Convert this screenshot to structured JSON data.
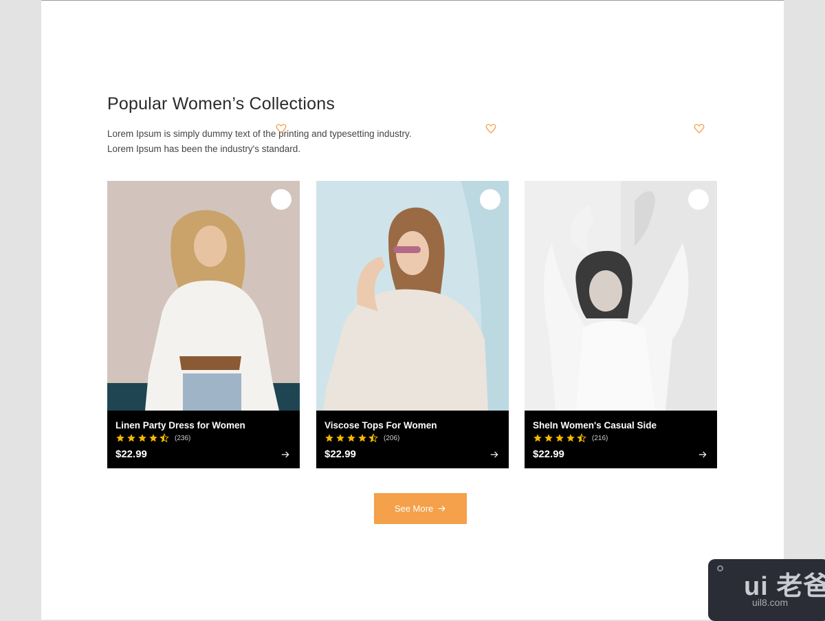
{
  "section": {
    "title": "Popular Women’s Collections",
    "description_line1": "Lorem Ipsum is simply dummy text of the printing and typesetting industry.",
    "description_line2": "Lorem Ipsum has been the industry's standard."
  },
  "products": [
    {
      "name": "Linen Party Dress for Women",
      "rating": 4.5,
      "reviews": "(236)",
      "price": "$22.99"
    },
    {
      "name": "Viscose Tops For Women",
      "rating": 4.5,
      "reviews": "(206)",
      "price": "$22.99"
    },
    {
      "name": "SheIn Women's Casual Side",
      "rating": 4.5,
      "reviews": "(216)",
      "price": "$22.99"
    }
  ],
  "actions": {
    "see_more_label": "See More"
  },
  "watermark": {
    "logo": "ui 老爸",
    "site": "uil8.com"
  },
  "colors": {
    "accent": "#f5a04b",
    "star": "#f5b800",
    "card_footer": "#000000",
    "page_bg": "#ffffff",
    "outer_bg": "#e3e3e3"
  },
  "icons": {
    "favorite": "heart-outline-icon",
    "arrow": "arrow-right-icon",
    "star": "star-icon",
    "half_star": "star-half-icon"
  }
}
